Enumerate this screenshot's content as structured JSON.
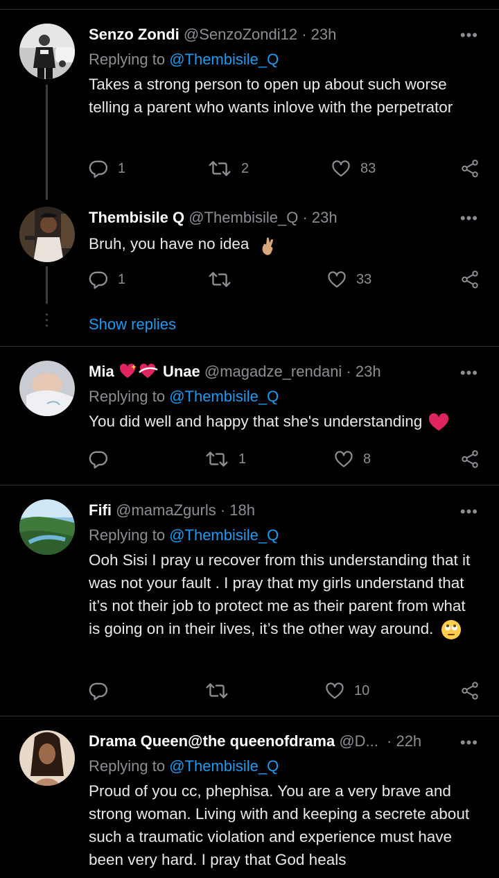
{
  "tweets": [
    {
      "name": "Senzo Zondi",
      "handle": "@SenzoZondi12",
      "time": "· 23h",
      "replying_prefix": "Replying to ",
      "replying_to": "@Thembisile_Q",
      "text": "Takes a strong person to open up about such worse telling a parent who wants inlove with the perpetrator",
      "replies": "1",
      "retweets": "2",
      "likes": "83"
    },
    {
      "name": "Thembisile Q",
      "handle": "@Thembisile_Q",
      "time": "· 23h",
      "text": "Bruh, you have no idea",
      "replies": "1",
      "retweets": "",
      "likes": "33",
      "show_replies": "Show replies"
    },
    {
      "name_part1": "Mia",
      "name_part2": "Unae",
      "handle": "@magadze_rendani",
      "time": "· 23h",
      "replying_prefix": "Replying to ",
      "replying_to": "@Thembisile_Q",
      "text": "You did well and happy that she's understanding",
      "replies": "",
      "retweets": "1",
      "likes": "8"
    },
    {
      "name": "Fifi",
      "handle": "@mamaZgurls",
      "time": "· 18h",
      "replying_prefix": "Replying to ",
      "replying_to": "@Thembisile_Q",
      "text": "Ooh Sisi I pray u recover from this understanding that it was not your fault . I pray that my girls understand that it’s not their job to protect me as their parent from what is going on in their lives,  it’s the other way around.",
      "replies": "",
      "retweets": "",
      "likes": "10"
    },
    {
      "name": "Drama Queen@the queenofdrama",
      "handle": "@D...",
      "time": "· 22h",
      "replying_prefix": "Replying to ",
      "replying_to": "@Thembisile_Q",
      "text": "Proud of you cc, phephisa. You are a very brave and strong woman. Living with and keeping a secrete about such a traumatic violation and experience must have been very hard. I pray that God heals"
    }
  ],
  "more_glyph": "•••",
  "icons": [
    "reply-icon",
    "retweet-icon",
    "like-icon",
    "share-icon",
    "more-icon"
  ],
  "colors": {
    "background": "#000000",
    "mention": "#1d9bf0",
    "secondary": "#8b8f94",
    "divider": "#2f3336"
  }
}
